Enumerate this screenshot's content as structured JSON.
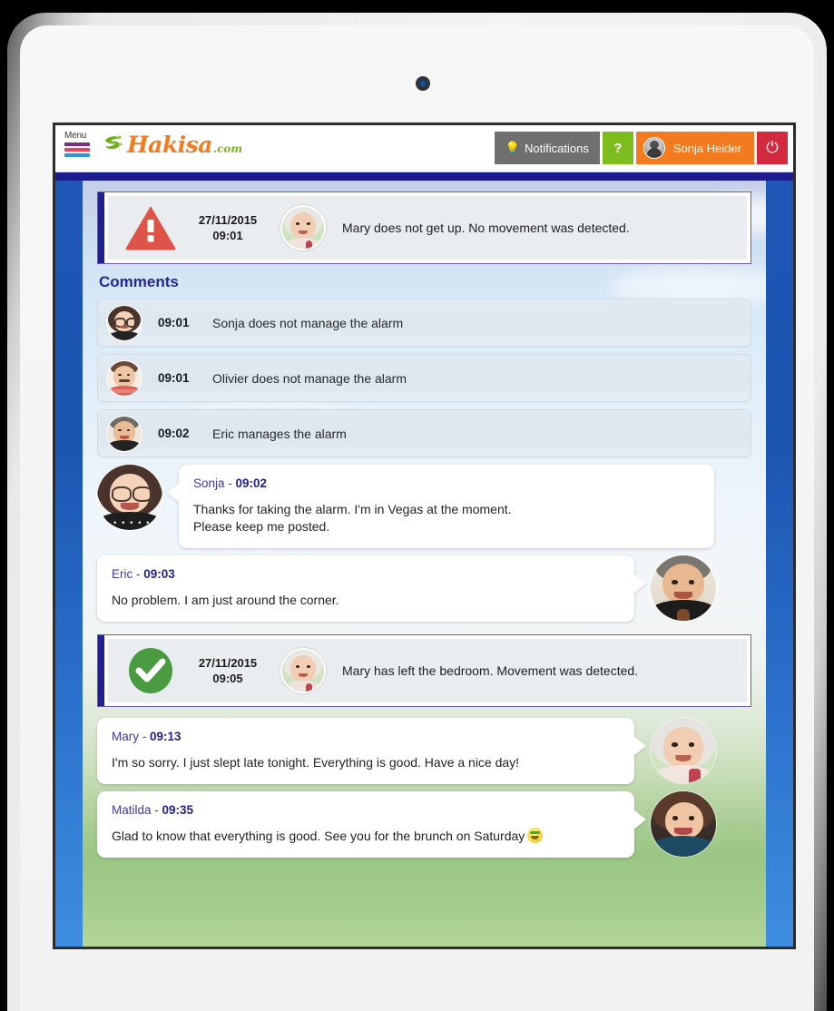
{
  "header": {
    "menu_label": "Menu",
    "logo_text": "Hakisa",
    "logo_suffix": ".com",
    "notifications_label": "Notifications",
    "help_label": "?",
    "user_name": "Sonja Heider",
    "power_label": "⏻",
    "colors": {
      "notifications_bg": "#6f6f6f",
      "help_bg": "#7dbe1e",
      "user_bg": "#f47a1f",
      "power_bg": "#d32a3f",
      "navbar": "#1c1c8f",
      "logo_orange": "#f47b20",
      "logo_green": "#7bb51f"
    }
  },
  "alert_event": {
    "icon": "warning-triangle-icon",
    "date": "27/11/2015",
    "time": "09:01",
    "message": "Mary does not get up. No movement was detected.",
    "accent_color": "#221f8f",
    "icon_color": "#df5449"
  },
  "comments_section": {
    "title": "Comments",
    "rows": [
      {
        "time": "09:01",
        "text": "Sonja does not manage the alarm",
        "avatar": "sonja-avatar"
      },
      {
        "time": "09:01",
        "text": "Olivier does not manage the alarm",
        "avatar": "olivier-avatar"
      },
      {
        "time": "09:02",
        "text": "Eric manages the alarm",
        "avatar": "eric-avatar"
      }
    ]
  },
  "messages": [
    {
      "id": "msg-sonja",
      "side": "left",
      "author": "Sonja",
      "separator": " - ",
      "time": "09:02",
      "body": "Thanks for taking the alarm. I'm in Vegas at the moment.\nPlease keep me posted.",
      "avatar": "sonja-avatar"
    },
    {
      "id": "msg-eric",
      "side": "right",
      "author": "Eric",
      "separator": " - ",
      "time": "09:03",
      "body": "No problem. I am just around the corner.",
      "avatar": "eric-avatar"
    }
  ],
  "success_event": {
    "icon": "check-circle-icon",
    "date": "27/11/2015",
    "time": "09:05",
    "message": "Mary has left the bedroom. Movement was detected.",
    "accent_color": "#221f8f",
    "icon_color": "#4a9b3f"
  },
  "messages_after": [
    {
      "id": "msg-mary",
      "side": "right",
      "author": "Mary",
      "separator": " - ",
      "time": "09:13",
      "body": "I'm so sorry. I just slept late tonight. Everything is good. Have a nice day!",
      "avatar": "mary-avatar"
    },
    {
      "id": "msg-matilda",
      "side": "right",
      "author": "Matilda",
      "separator": " - ",
      "time": "09:35",
      "body": "Glad to know that everything is good. See you for the brunch on Saturday",
      "emoji": "smiling-face-emoji",
      "avatar": "matilda-avatar"
    }
  ]
}
